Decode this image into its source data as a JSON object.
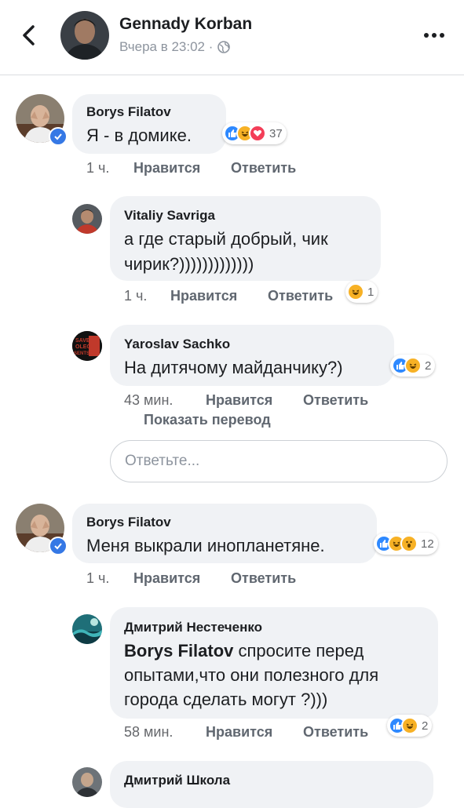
{
  "header": {
    "author": "Gennady Korban",
    "time": "Вчера в 23:02 ·"
  },
  "comments": [
    {
      "author": "Borys Filatov",
      "text": "Я - в домике.",
      "reaction_count": "37",
      "time": "1 ч.",
      "like_label": "Нравится",
      "reply_label": "Ответить"
    },
    {
      "author": "Vitaliy Savriga",
      "text_line1": "а где старый добрый, чик",
      "text_line2": "чирик?)))))))))))))",
      "reaction_count": "1",
      "time": "1 ч.",
      "like_label": "Нравится",
      "reply_label": "Ответить"
    },
    {
      "author": "Yaroslav Sachko",
      "text": "На дитячому майданчику?)",
      "reaction_count": "2",
      "time": "43 мин.",
      "like_label": "Нравится",
      "reply_label": "Ответить",
      "translate_label": "Показать перевод",
      "avatar_text": [
        "SAVE",
        "OLEG",
        "SENTSOV"
      ]
    },
    {
      "author": "Borys Filatov",
      "text": "Меня выкрали инопланетяне.",
      "reaction_count": "12",
      "time": "1 ч.",
      "like_label": "Нравится",
      "reply_label": "Ответить"
    },
    {
      "author": "Дмитрий Нестеченко",
      "mention": "Borys Filatov",
      "text_line1_rest": " спросите перед",
      "text_line2": "опытами,что они полезного для",
      "text_line3": "города сделать могут ?)))",
      "reaction_count": "2",
      "time": "58 мин.",
      "like_label": "Нравится",
      "reply_label": "Ответить"
    },
    {
      "author": "Дмитрий Школа"
    }
  ],
  "reply_box": {
    "placeholder": "Ответьте..."
  },
  "colors": {
    "accent": "#3578e5",
    "bubble": "#f0f2f5",
    "meta": "#65676b",
    "like": "#2e89ff",
    "haha": "#f7b125",
    "love": "#f33e58"
  },
  "icons": [
    "back-arrow-icon",
    "globe-icon",
    "more-icon",
    "verified-badge-icon",
    "like-reaction-icon",
    "haha-reaction-icon",
    "love-reaction-icon",
    "wow-reaction-icon"
  ]
}
